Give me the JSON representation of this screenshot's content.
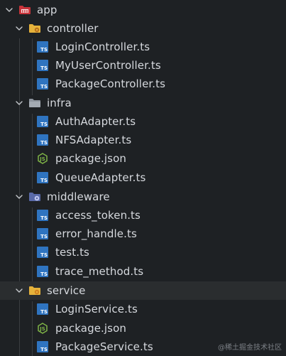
{
  "explorer": {
    "root": {
      "name": "app",
      "icon": "app-folder-icon",
      "icon_color": "#e0444b"
    },
    "folders": [
      {
        "name": "controller",
        "icon": "controller-folder-icon",
        "files": [
          {
            "name": "LoginController.ts",
            "icon": "typescript-file-icon"
          },
          {
            "name": "MyUserController.ts",
            "icon": "typescript-file-icon"
          },
          {
            "name": "PackageController.ts",
            "icon": "typescript-file-icon"
          }
        ]
      },
      {
        "name": "infra",
        "icon": "folder-icon",
        "files": [
          {
            "name": "AuthAdapter.ts",
            "icon": "typescript-file-icon"
          },
          {
            "name": "NFSAdapter.ts",
            "icon": "typescript-file-icon"
          },
          {
            "name": "package.json",
            "icon": "nodejs-file-icon"
          },
          {
            "name": "QueueAdapter.ts",
            "icon": "typescript-file-icon"
          }
        ]
      },
      {
        "name": "middleware",
        "icon": "middleware-folder-icon",
        "files": [
          {
            "name": "access_token.ts",
            "icon": "typescript-file-icon"
          },
          {
            "name": "error_handle.ts",
            "icon": "typescript-file-icon"
          },
          {
            "name": "test.ts",
            "icon": "typescript-file-icon"
          },
          {
            "name": "trace_method.ts",
            "icon": "typescript-file-icon"
          }
        ]
      },
      {
        "name": "service",
        "icon": "service-folder-icon",
        "files": [
          {
            "name": "LoginService.ts",
            "icon": "typescript-file-icon"
          },
          {
            "name": "package.json",
            "icon": "nodejs-file-icon"
          },
          {
            "name": "PackageService.ts",
            "icon": "typescript-file-icon"
          }
        ]
      }
    ],
    "ts_badge_text": "TS",
    "colors": {
      "background": "#1e2124",
      "selected_row": "#2a2d2f",
      "ts_blue": "#2f74c0",
      "folder_yellow": "#e5b23b",
      "node_green": "#7fb447"
    }
  },
  "watermark": "@稀土掘金技术社区"
}
